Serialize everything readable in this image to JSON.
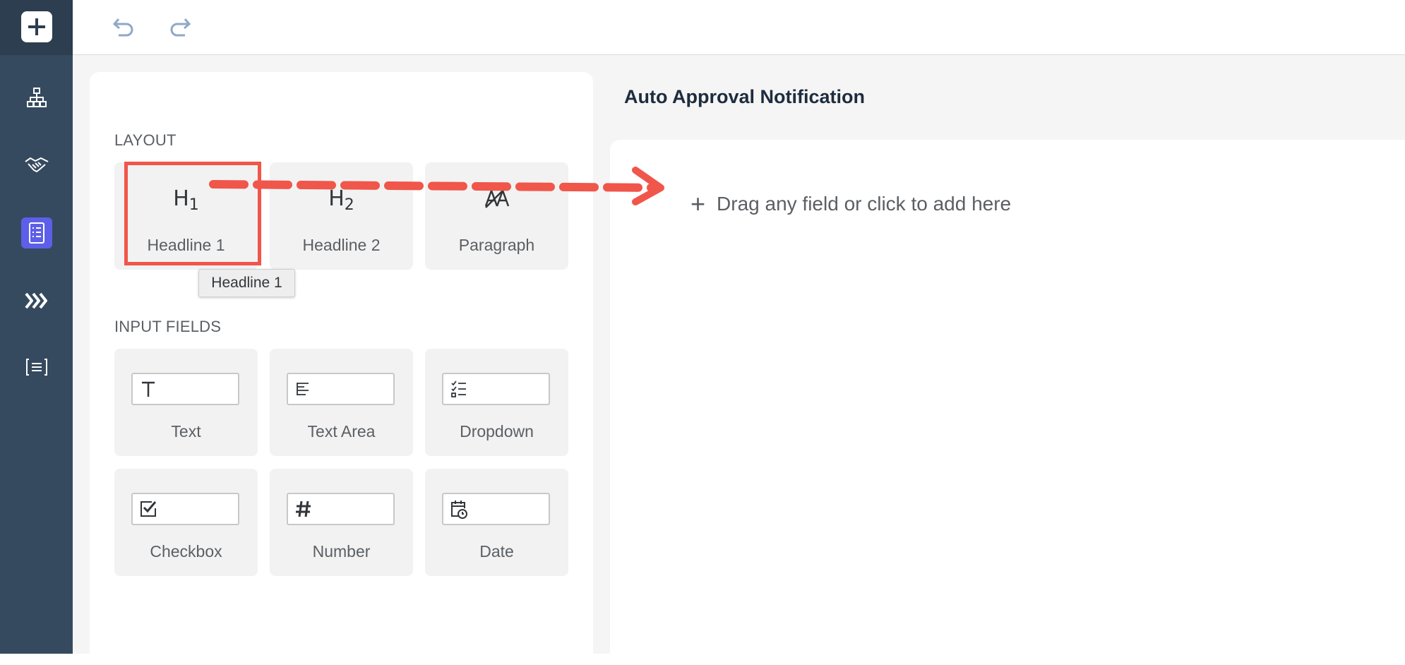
{
  "rail": {
    "items": [
      "add-icon",
      "hierarchy-icon",
      "handshake-icon",
      "form-icon",
      "chevrons-icon",
      "list-bracket-icon"
    ],
    "active_color": "#5d5fe8"
  },
  "toolbar": {
    "undo_icon": "undo-icon",
    "redo_icon": "redo-icon"
  },
  "palette": {
    "layout_title": "LAYOUT",
    "input_fields_title": "INPUT FIELDS",
    "layout_items": [
      {
        "label": "Headline 1",
        "glyph": "H",
        "sub": "1"
      },
      {
        "label": "Headline 2",
        "glyph": "H",
        "sub": "2"
      },
      {
        "label": "Paragraph",
        "glyph": "paragraph-icon"
      }
    ],
    "input_items": [
      {
        "label": "Text",
        "icon": "text-icon"
      },
      {
        "label": "Text Area",
        "icon": "text-area-icon"
      },
      {
        "label": "Dropdown",
        "icon": "dropdown-icon"
      },
      {
        "label": "Checkbox",
        "icon": "checkbox-icon"
      },
      {
        "label": "Number",
        "icon": "number-icon"
      },
      {
        "label": "Date",
        "icon": "date-icon"
      }
    ],
    "tooltip": "Headline 1"
  },
  "form": {
    "title": "Auto Approval Notification",
    "drop_hint": "Drag any field or click to add here"
  },
  "annotation": {
    "color": "#f0564a"
  }
}
